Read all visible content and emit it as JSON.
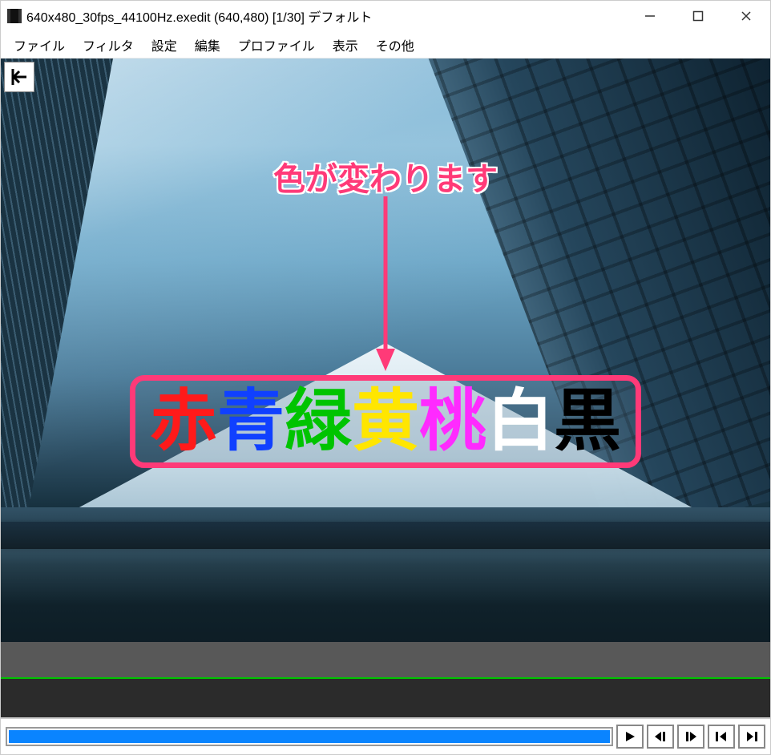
{
  "titlebar": {
    "title": "640x480_30fps_44100Hz.exedit (640,480)  [1/30]  デフォルト"
  },
  "menu": {
    "file": "ファイル",
    "filter": "フィルタ",
    "settings": "設定",
    "edit": "編集",
    "profile": "プロファイル",
    "view": "表示",
    "other": "その他"
  },
  "annotation": {
    "label": "色が変わります"
  },
  "color_chars": {
    "red": "赤",
    "blue": "青",
    "green": "緑",
    "yellow": "黄",
    "pink": "桃",
    "white": "白",
    "black": "黒"
  }
}
